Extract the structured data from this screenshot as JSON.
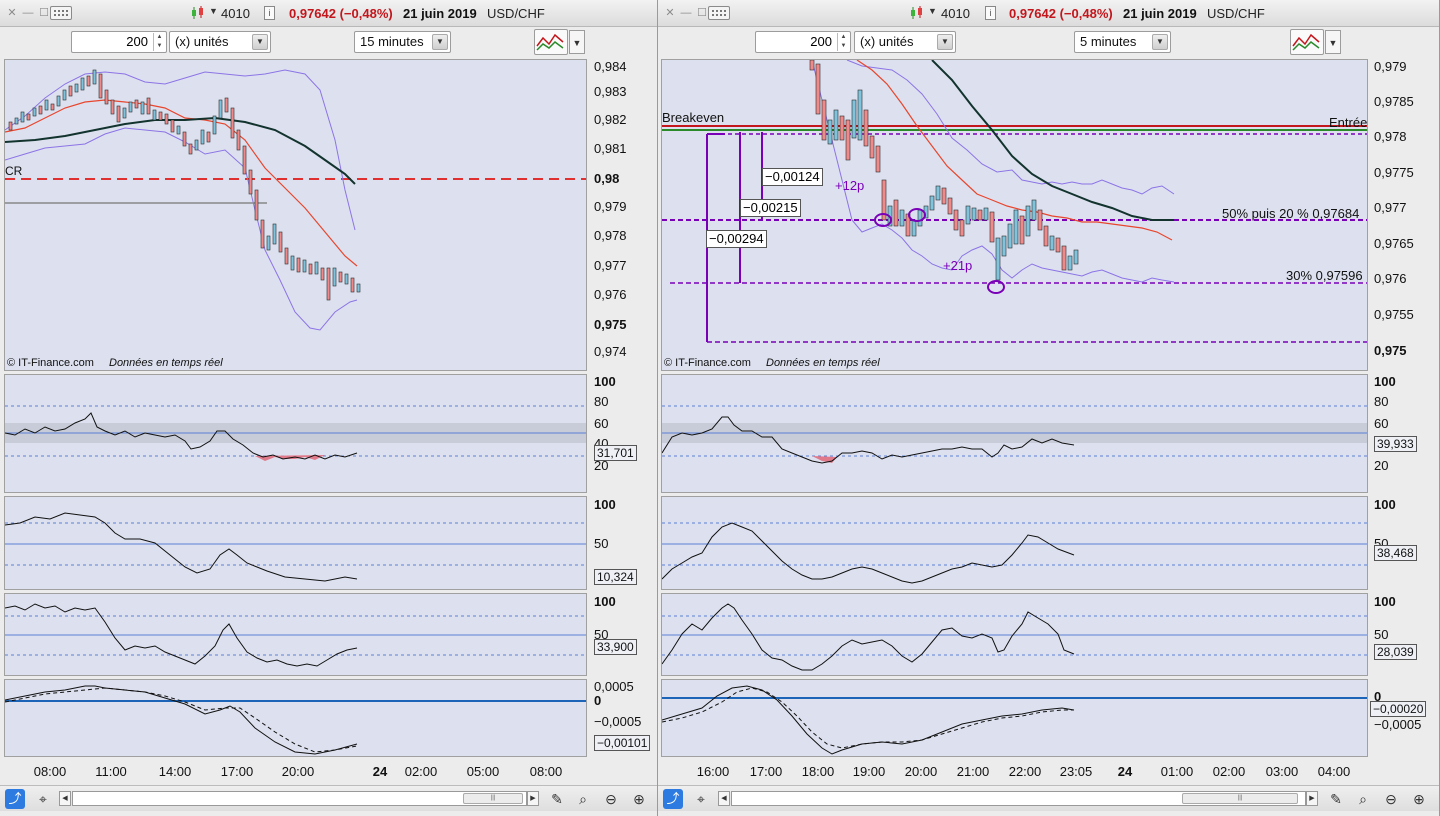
{
  "colors": {
    "panel_bg": "#dde1ef",
    "price_down": "#c2161c",
    "purple": "#7a00b8",
    "ma_red": "#e8462e",
    "ma_dark": "#12332e",
    "bollinger": "#8c74e6",
    "zero_line": "#1b64b8"
  },
  "windows": [
    {
      "title": {
        "ticker_code": "4010",
        "price_change": "0,97642 (−0,48%)",
        "date": "21 juin 2019",
        "pair": "USD/CHF"
      },
      "toolbar": {
        "count_value": "200",
        "units": "(x) unités",
        "timeframe": "15 minutes"
      },
      "price_axis": [
        "0,984",
        "0,983",
        "0,982",
        "0,981",
        "0,98",
        "0,979",
        "0,978",
        "0,977",
        "0,976",
        "0,975",
        "0,974"
      ],
      "price_labels": {
        "cr": "CR"
      },
      "copyright": {
        "brand": "© IT-Finance.com",
        "realtime": "Données en temps réel"
      },
      "indicators": [
        {
          "ticks": [
            "100",
            "80",
            "60",
            "40",
            "20"
          ],
          "value": "31,701"
        },
        {
          "ticks": [
            "100",
            "50"
          ],
          "value": "10,324"
        },
        {
          "ticks": [
            "100",
            "50"
          ],
          "value": "33,900"
        },
        {
          "ticks": [
            "0,0005",
            "0",
            "−0,0005"
          ],
          "value": "−0,00101"
        }
      ],
      "time_axis": [
        "08:00",
        "11:00",
        "14:00",
        "17:00",
        "20:00",
        "24",
        "02:00",
        "05:00",
        "08:00"
      ]
    },
    {
      "title": {
        "ticker_code": "4010",
        "price_change": "0,97642 (−0,48%)",
        "date": "21 juin 2019",
        "pair": "USD/CHF"
      },
      "toolbar": {
        "count_value": "200",
        "units": "(x) unités",
        "timeframe": "5 minutes"
      },
      "price_axis": [
        "0,979",
        "0,9785",
        "0,978",
        "0,9775",
        "0,977",
        "0,9765",
        "0,976",
        "0,9755",
        "0,975"
      ],
      "annotations": {
        "breakeven": "Breakeven",
        "entree": "Entrée",
        "level_50_20": "50% puis 20 % 0,97684",
        "level_30": "30% 0,97596",
        "diff1": "−0,00124",
        "diff2": "−0,00215",
        "diff3": "−0,00294",
        "pips1": "+12p",
        "pips2": "+21p"
      },
      "copyright": {
        "brand": "© IT-Finance.com",
        "realtime": "Données en temps réel"
      },
      "indicators": [
        {
          "ticks": [
            "100",
            "80",
            "60",
            "40",
            "20"
          ],
          "value": "39,933"
        },
        {
          "ticks": [
            "100",
            "50"
          ],
          "value": "38,468"
        },
        {
          "ticks": [
            "100",
            "50"
          ],
          "value": "28,039"
        },
        {
          "ticks": [
            "0",
            "−0,0005"
          ],
          "value": "−0,00020"
        }
      ],
      "time_axis": [
        "16:00",
        "17:00",
        "18:00",
        "19:00",
        "20:00",
        "21:00",
        "22:00",
        "23:05",
        "24",
        "01:00",
        "02:00",
        "03:00",
        "04:00"
      ]
    }
  ]
}
